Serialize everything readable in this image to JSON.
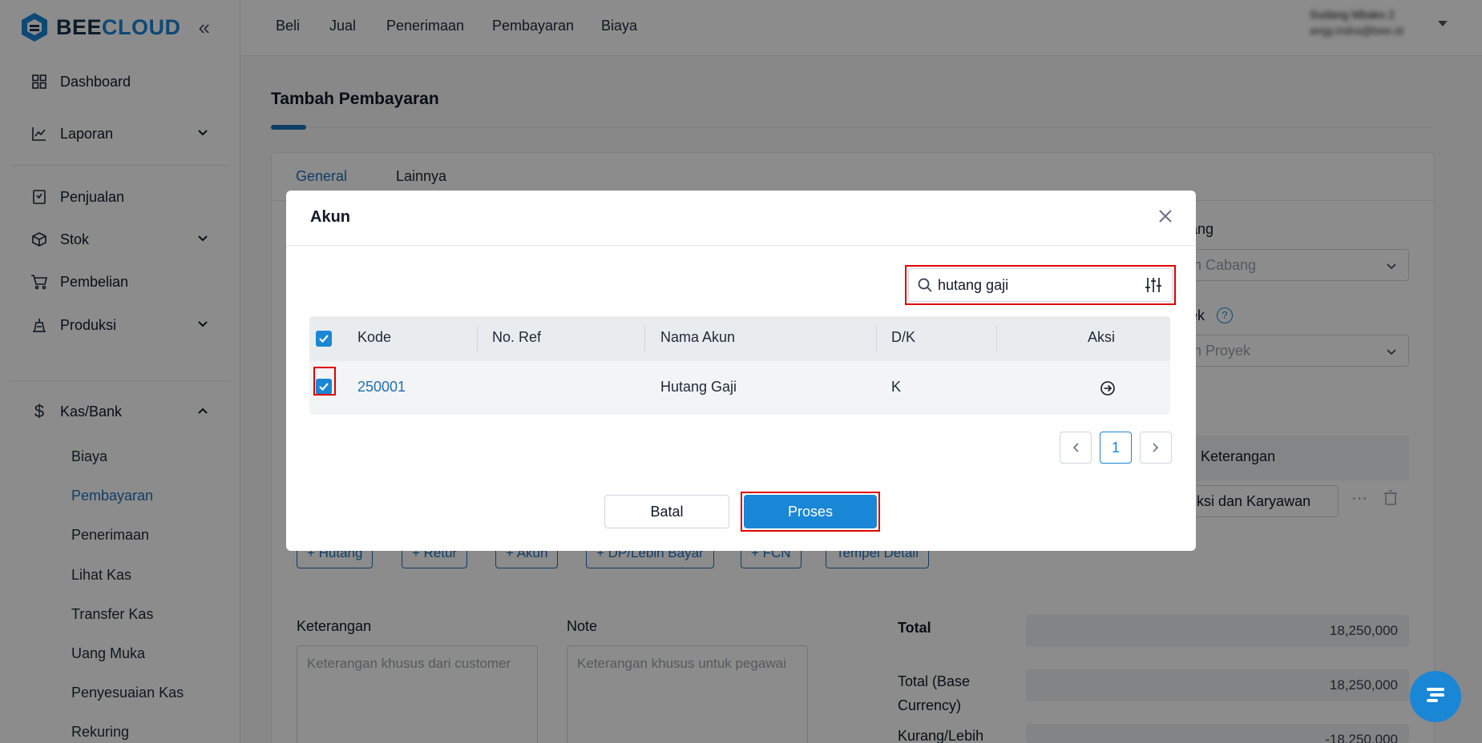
{
  "brand": {
    "part1": "BEE",
    "part2": "CLOUD"
  },
  "sidebar": {
    "items": [
      {
        "label": "Dashboard"
      },
      {
        "label": "Laporan"
      },
      {
        "label": "Penjualan"
      },
      {
        "label": "Stok"
      },
      {
        "label": "Pembelian"
      },
      {
        "label": "Produksi"
      },
      {
        "label": "Kas/Bank"
      }
    ],
    "kasbank_sub": [
      {
        "label": "Biaya"
      },
      {
        "label": "Pembayaran"
      },
      {
        "label": "Penerimaan"
      },
      {
        "label": "Lihat Kas"
      },
      {
        "label": "Transfer Kas"
      },
      {
        "label": "Uang Muka"
      },
      {
        "label": "Penyesuaian Kas"
      },
      {
        "label": "Rekuring"
      }
    ]
  },
  "topnav": [
    "Beli",
    "Jual",
    "Penerimaan",
    "Pembayaran",
    "Biaya"
  ],
  "user": {
    "name": "Sudang Mbako 2",
    "email": "angy.indra@bee.id"
  },
  "page": {
    "title": "Tambah Pembayaran",
    "tabs": [
      "General",
      "Lainnya"
    ],
    "cabang_label": "ang",
    "cabang_placeholder": "ih Cabang",
    "proyek_label": "ek",
    "proyek_placeholder": "ih Proyek",
    "keterangan_header": "Keterangan",
    "row_keterangan": "eksi dan Karyawan",
    "add_buttons": [
      "+ Hutang",
      "+ Retur",
      "+ Akun",
      "+ DP/Lebih Bayar",
      "+ FCN",
      "Tempel Detail"
    ],
    "keterangan_label": "Keterangan",
    "keterangan_placeholder": "Keterangan khusus dari customer",
    "note_label": "Note",
    "note_placeholder": "Keterangan khusus untuk pegawai",
    "totals": [
      {
        "label": "Total",
        "value": "18,250,000"
      },
      {
        "label": "Total (Base Currency)",
        "value": "18,250,000"
      },
      {
        "label": "Kurang/Lebih",
        "value": "-18,250,000"
      }
    ]
  },
  "modal": {
    "title": "Akun",
    "search": {
      "value": "hutang gaji",
      "placeholder": ""
    },
    "columns": [
      "Kode",
      "No. Ref",
      "Nama Akun",
      "D/K",
      "Aksi"
    ],
    "rows": [
      {
        "kode": "250001",
        "no_ref": "",
        "nama_akun": "Hutang Gaji",
        "dk": "K",
        "checked": true
      }
    ],
    "pagination": {
      "current": "1"
    },
    "cancel_label": "Batal",
    "submit_label": "Proses"
  },
  "colors": {
    "accent": "#1a86d6",
    "link": "#1e6fb8",
    "highlight": "#e00000"
  },
  "icons": [
    "dashboard-icon",
    "chart-icon",
    "receipt-icon",
    "box-icon",
    "cart-icon",
    "factory-icon",
    "dollar-icon",
    "search-icon",
    "filter-icon",
    "close-icon",
    "arrow-circle-right-icon",
    "chat-icon"
  ]
}
